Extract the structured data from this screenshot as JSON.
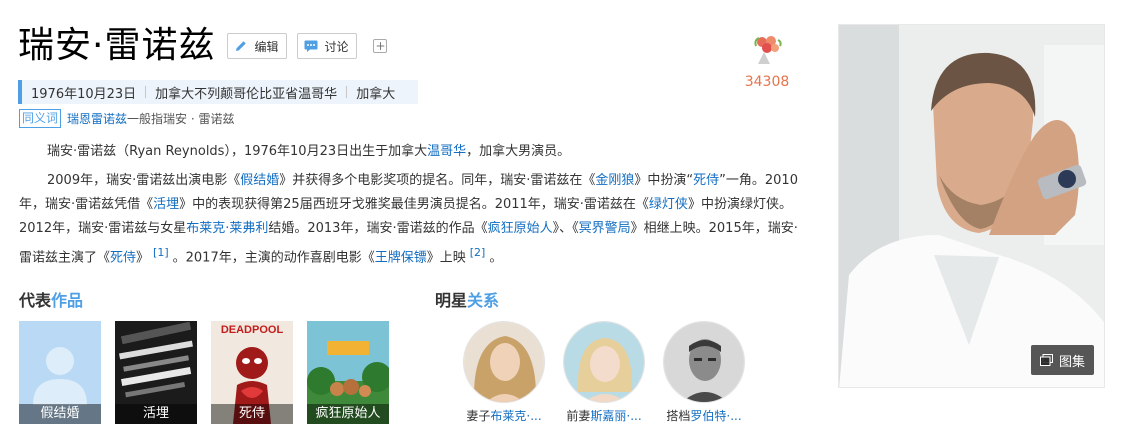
{
  "header": {
    "title": "瑞安·雷诺兹",
    "edit_label": "编辑",
    "discuss_label": "讨论",
    "add_symbol": "+"
  },
  "basic_info": [
    "1976年10月23日",
    "加拿大不列颠哥伦比亚省温哥华",
    "加拿大"
  ],
  "synonym": {
    "tag": "同义词",
    "link": "瑞恩雷诺兹",
    "rest": "一般指瑞安 · 雷诺兹"
  },
  "summary": {
    "p1": {
      "a": "瑞安·雷诺兹（Ryan Reynolds），1976年10月23日出生于加拿大",
      "link": "温哥华",
      "b": "，加拿大男演员。"
    },
    "p2": {
      "t1": "2009年，瑞安·雷诺兹出演电影《",
      "l1": "假结婚",
      "t2": "》并获得多个电影奖项的提名。同年，瑞安·雷诺兹在《",
      "l2": "金刚狼",
      "t3": "》中扮演“",
      "l3": "死侍",
      "t4": "”一角。2010年，瑞安·雷诺兹凭借《",
      "l4": "活埋",
      "t5": "》中的表现获得第25届西班牙戈雅奖最佳男演员提名。2011年，瑞安·雷诺兹在《",
      "l5": "绿灯侠",
      "t6": "》中扮演绿灯侠。2012年，瑞安·雷诺兹与女星",
      "l6": "布莱克·莱弗利",
      "t7": "结婚。2013年，瑞安·雷诺兹的作品《",
      "l7": "疯狂原始人",
      "t8": "》、《",
      "l8": "冥界警局",
      "t9": "》相继上映。2015年，瑞安·雷诺兹主演了《",
      "l9": "死侍",
      "t10": "》",
      "ref1": "[1]",
      "t11": "。2017年，主演的动作喜剧电影《",
      "l10": "王牌保镖",
      "t12": "》上映",
      "ref2": "[2]",
      "t13": "。"
    }
  },
  "works": {
    "title_prefix": "代表",
    "title_accent": "作品",
    "items": [
      {
        "label": "假结婚"
      },
      {
        "label": "活埋"
      },
      {
        "label": "死侍",
        "poster_text": "DEADPOOL"
      },
      {
        "label": "疯狂原始人"
      }
    ]
  },
  "relations": {
    "title_prefix": "明星",
    "title_accent": "关系",
    "items": [
      {
        "role": "妻子",
        "name": "布莱克·..."
      },
      {
        "role": "前妻",
        "name": "斯嘉丽·..."
      },
      {
        "role": "搭档",
        "name": "罗伯特·..."
      }
    ]
  },
  "likes": {
    "count": "34308"
  },
  "photo": {
    "album_label": "图集"
  },
  "colors": {
    "link": "#136ec2",
    "accent": "#4f9fe5",
    "like": "#e5744c"
  }
}
